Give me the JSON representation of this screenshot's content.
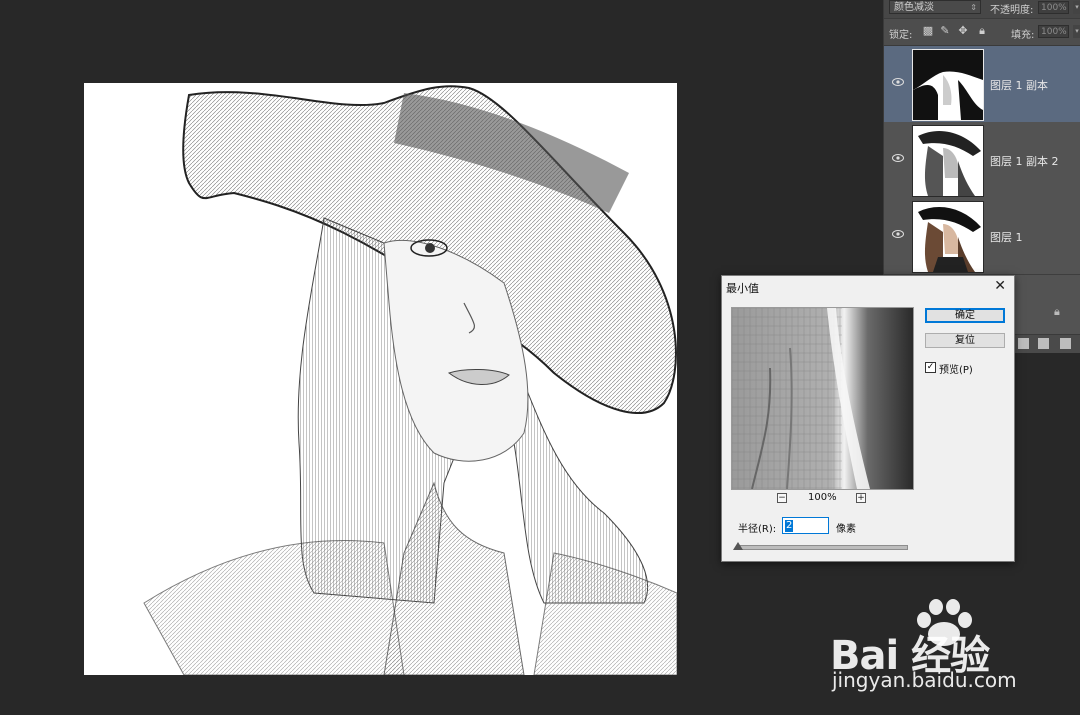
{
  "layers_panel": {
    "blend_mode": "颜色减淡",
    "opacity_label": "不透明度:",
    "opacity_value": "100%",
    "lock_label": "锁定:",
    "fill_label": "填充:",
    "fill_value": "100%",
    "layers": [
      {
        "name": "图层 1 副本",
        "selected": true
      },
      {
        "name": "图层 1 副本 2",
        "selected": false
      },
      {
        "name": "图层 1",
        "selected": false
      }
    ]
  },
  "dialog": {
    "title": "最小值",
    "ok_label": "确定",
    "reset_label": "复位",
    "preview_label": "预览(P)",
    "preview_checked": true,
    "zoom": "100%",
    "radius_label": "半径(R):",
    "radius_value": "2",
    "unit_label": "像素"
  },
  "watermark": {
    "brand": "Bai 经验",
    "url": "jingyan.baidu.com"
  },
  "colors": {
    "workspace": "#282828",
    "panel": "#535353",
    "selected_layer": "#5b6a80",
    "dialog": "#f0f0f0",
    "accent": "#0078d7"
  }
}
